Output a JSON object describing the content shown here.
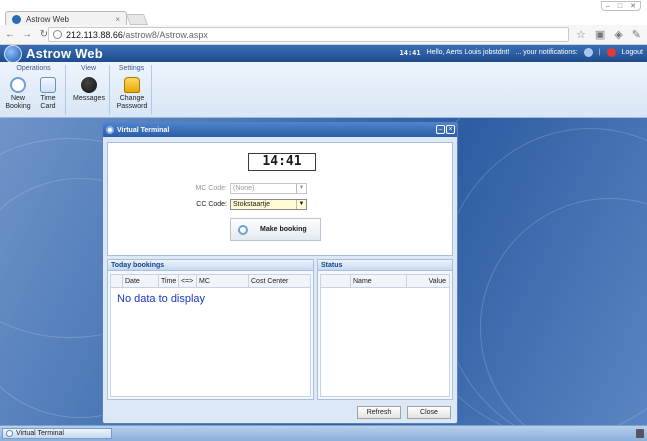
{
  "browser": {
    "tab_title": "Astrow Web",
    "tab_close": "×",
    "url_host": "212.113.88.66",
    "url_path": "/astrow8/Astrow.aspx",
    "window_buttons": [
      "–",
      "□",
      "✕"
    ]
  },
  "header": {
    "app_name": "Astrow Web",
    "time": "14:41",
    "greeting": "Hello, Aerts Louis jobstdnt!",
    "notifications": "... your notifications:",
    "separator": "|",
    "logout": "Logout"
  },
  "ribbon": {
    "groups": [
      {
        "label": "Operations",
        "buttons": [
          "New Booking",
          "Time Card"
        ]
      },
      {
        "label": "View",
        "buttons": [
          "Messages"
        ]
      },
      {
        "label": "Settings",
        "buttons": [
          "Change Password"
        ]
      }
    ],
    "new_booking_l1": "New",
    "new_booking_l2": "Booking",
    "time_card_l1": "Time",
    "time_card_l2": "Card",
    "messages": "Messages",
    "change_password_l1": "Change",
    "change_password_l2": "Password"
  },
  "terminal": {
    "title": "Virtual Terminal",
    "clock": "14:41",
    "mc_label": "MC Code:",
    "mc_value": "(None)",
    "cc_label": "CC Code:",
    "cc_value": "Stokstaartje",
    "make_booking": "Make booking",
    "bookings_title": "Today bookings",
    "bookings_columns": [
      "Date",
      "Time",
      "<=>",
      "MC",
      "Cost Center"
    ],
    "no_data": "No data to display",
    "status_title": "Status",
    "status_columns": [
      "",
      "Name",
      "Value"
    ],
    "refresh": "Refresh",
    "close": "Close"
  },
  "taskbar": {
    "item": "Virtual Terminal"
  }
}
